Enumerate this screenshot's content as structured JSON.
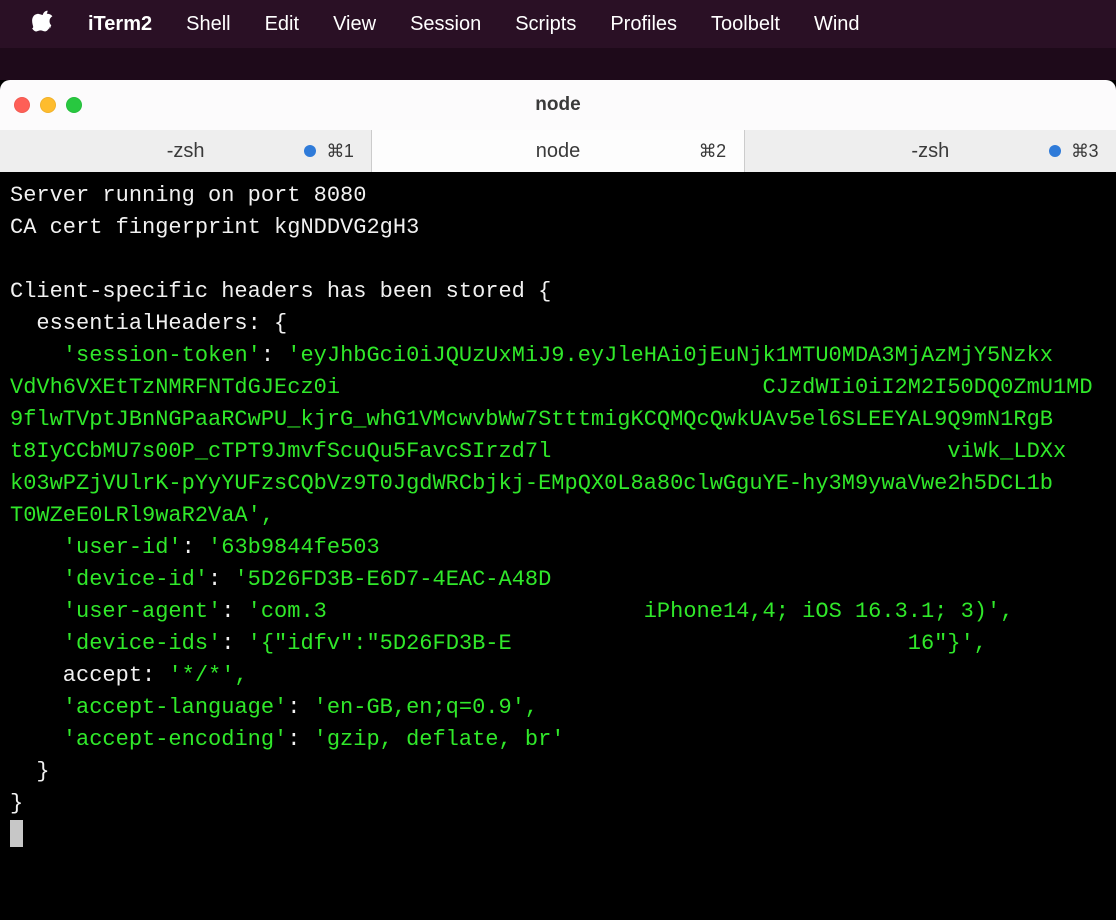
{
  "menubar": {
    "app_name": "iTerm2",
    "items": [
      "Shell",
      "Edit",
      "View",
      "Session",
      "Scripts",
      "Profiles",
      "Toolbelt",
      "Wind"
    ]
  },
  "window": {
    "title": "node"
  },
  "tabs": [
    {
      "label": "-zsh",
      "has_dot": true,
      "shortcut": "⌘1",
      "active": false
    },
    {
      "label": "node",
      "has_dot": false,
      "shortcut": "⌘2",
      "active": true
    },
    {
      "label": "-zsh",
      "has_dot": true,
      "shortcut": "⌘3",
      "active": false
    }
  ],
  "terminal": {
    "lines": [
      {
        "type": "plain",
        "text": "Server running on port 8080"
      },
      {
        "type": "plain",
        "text": "CA cert fingerprint kgNDDVG2gH3"
      },
      {
        "type": "plain",
        "text": ""
      },
      {
        "type": "plain",
        "text": "Client-specific headers has been stored {"
      },
      {
        "type": "plain",
        "text": "  essentialHeaders: {"
      },
      {
        "type": "kv-long",
        "indent": "    ",
        "key": "'session-token'",
        "sep": ": ",
        "vlines": [
          "'eyJhbGci0iJQUzUxMiJ9.eyJleHAi0jEuNjk1MTU0MDA3MjAzMjY5Nzkx",
          "VdVh6VXEtTzNMRFNTdGJEcz0i                                CJzdWIi0iI2M2I50DQ0ZmU1MD",
          "9flwTVptJBnNGPaaRCwPU_kjrG_whG1VMcwvbWw7StttmigKCQMQcQwkUAv5el6SLEEYAL9Q9mN1RgB",
          "t8IyCCbMU7s00P_cTPT9JmvfScuQu5FavcSIrzd7l                              viWk_LDXx",
          "k03wPZjVUlrK-pYyYUFzsCQbVz9T0JgdWRCbjkj-EMpQX0L8a80clwGguYE-hy3M9ywaVwe2h5DCL1b",
          "T0WZeE0LRl9waR2VaA',"
        ]
      },
      {
        "type": "kv",
        "indent": "    ",
        "key": "'user-id'",
        "sep": ": ",
        "value": "'63b9844fe503"
      },
      {
        "type": "kv",
        "indent": "    ",
        "key": "'device-id'",
        "sep": ": ",
        "value": "'5D26FD3B-E6D7-4EAC-A48D"
      },
      {
        "type": "kv-split",
        "indent": "    ",
        "key": "'user-agent'",
        "sep": ": ",
        "value_left": "'com.3",
        "gap": "                        ",
        "value_right": "iPhone14,4; iOS 16.3.1; 3)',"
      },
      {
        "type": "kv-split",
        "indent": "    ",
        "key": "'device-ids'",
        "sep": ": ",
        "value_left": "'{\"idfv\":\"5D26FD3B-E",
        "gap": "                              ",
        "value_right": "16\"}',"
      },
      {
        "type": "kv-plainkey",
        "indent": "    ",
        "key": "accept",
        "sep": ": ",
        "value": "'*/*',"
      },
      {
        "type": "kv",
        "indent": "    ",
        "key": "'accept-language'",
        "sep": ": ",
        "value": "'en-GB,en;q=0.9',"
      },
      {
        "type": "kv",
        "indent": "    ",
        "key": "'accept-encoding'",
        "sep": ": ",
        "value": "'gzip, deflate, br'"
      },
      {
        "type": "plain",
        "text": "  }"
      },
      {
        "type": "plain",
        "text": "}"
      }
    ]
  }
}
